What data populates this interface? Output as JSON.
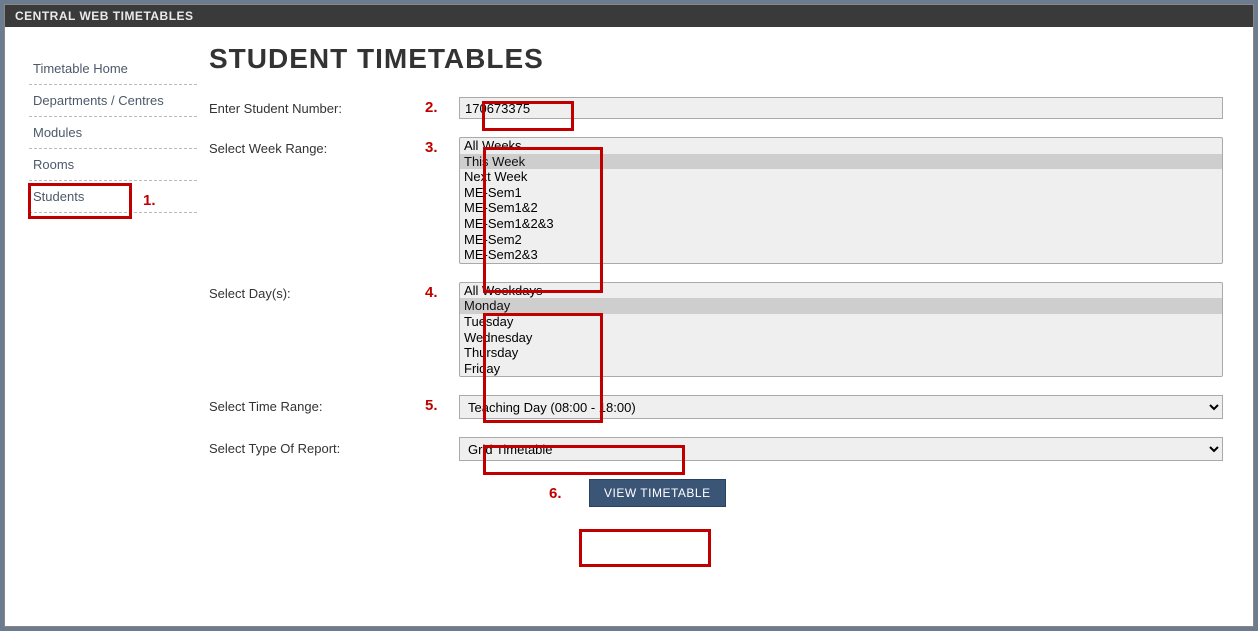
{
  "titleBar": "CENTRAL WEB TIMETABLES",
  "sidebar": {
    "items": [
      "Timetable Home",
      "Departments / Centres",
      "Modules",
      "Rooms",
      "Students"
    ]
  },
  "page": {
    "heading": "STUDENT TIMETABLES"
  },
  "annotations": {
    "a1": "1.",
    "a2": "2.",
    "a3": "3.",
    "a4": "4.",
    "a5": "5.",
    "a6": "6."
  },
  "form": {
    "studentNumber": {
      "label": "Enter Student Number:",
      "value": "170673375"
    },
    "weekRange": {
      "label": "Select Week Range:",
      "options": [
        "All Weeks",
        "This Week",
        "Next Week",
        "ME-Sem1",
        "ME-Sem1&2",
        "ME-Sem1&2&3",
        "ME-Sem2",
        "ME-Sem2&3"
      ],
      "selected": "This Week"
    },
    "days": {
      "label": "Select Day(s):",
      "options": [
        "All Weekdays",
        "Monday",
        "Tuesday",
        "Wednesday",
        "Thursday",
        "Friday"
      ],
      "selected": "Monday"
    },
    "timeRange": {
      "label": "Select Time Range:",
      "options": [
        "Teaching Day (08:00 - 18:00)"
      ],
      "selected": "Teaching Day (08:00 - 18:00)"
    },
    "reportType": {
      "label": "Select Type Of Report:",
      "options": [
        "Grid Timetable"
      ],
      "selected": "Grid Timetable"
    },
    "submitLabel": "VIEW TIMETABLE"
  }
}
